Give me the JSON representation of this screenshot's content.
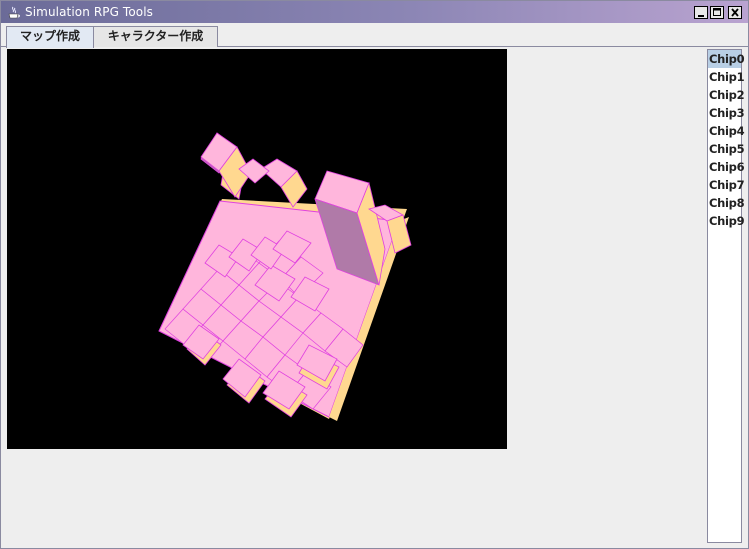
{
  "window": {
    "title": "Simulation RPG Tools"
  },
  "tabs": [
    {
      "label": "マップ作成",
      "selected": true
    },
    {
      "label": "キャラクター作成",
      "selected": false
    }
  ],
  "chip_list": {
    "items": [
      "Chip0",
      "Chip1",
      "Chip2",
      "Chip3",
      "Chip4",
      "Chip5",
      "Chip6",
      "Chip7",
      "Chip8",
      "Chip9"
    ],
    "selected_index": 0
  },
  "scene": {
    "background_color": "#000000",
    "block_top_color": "#ffb6dc",
    "block_side_color": "#ffd890",
    "block_shade_color": "#b07aa8",
    "block_edge_color": "#e040e0"
  },
  "icons": {
    "app": "java-cup-icon",
    "minimize": "minimize-icon",
    "maximize": "maximize-icon",
    "close": "close-icon"
  }
}
